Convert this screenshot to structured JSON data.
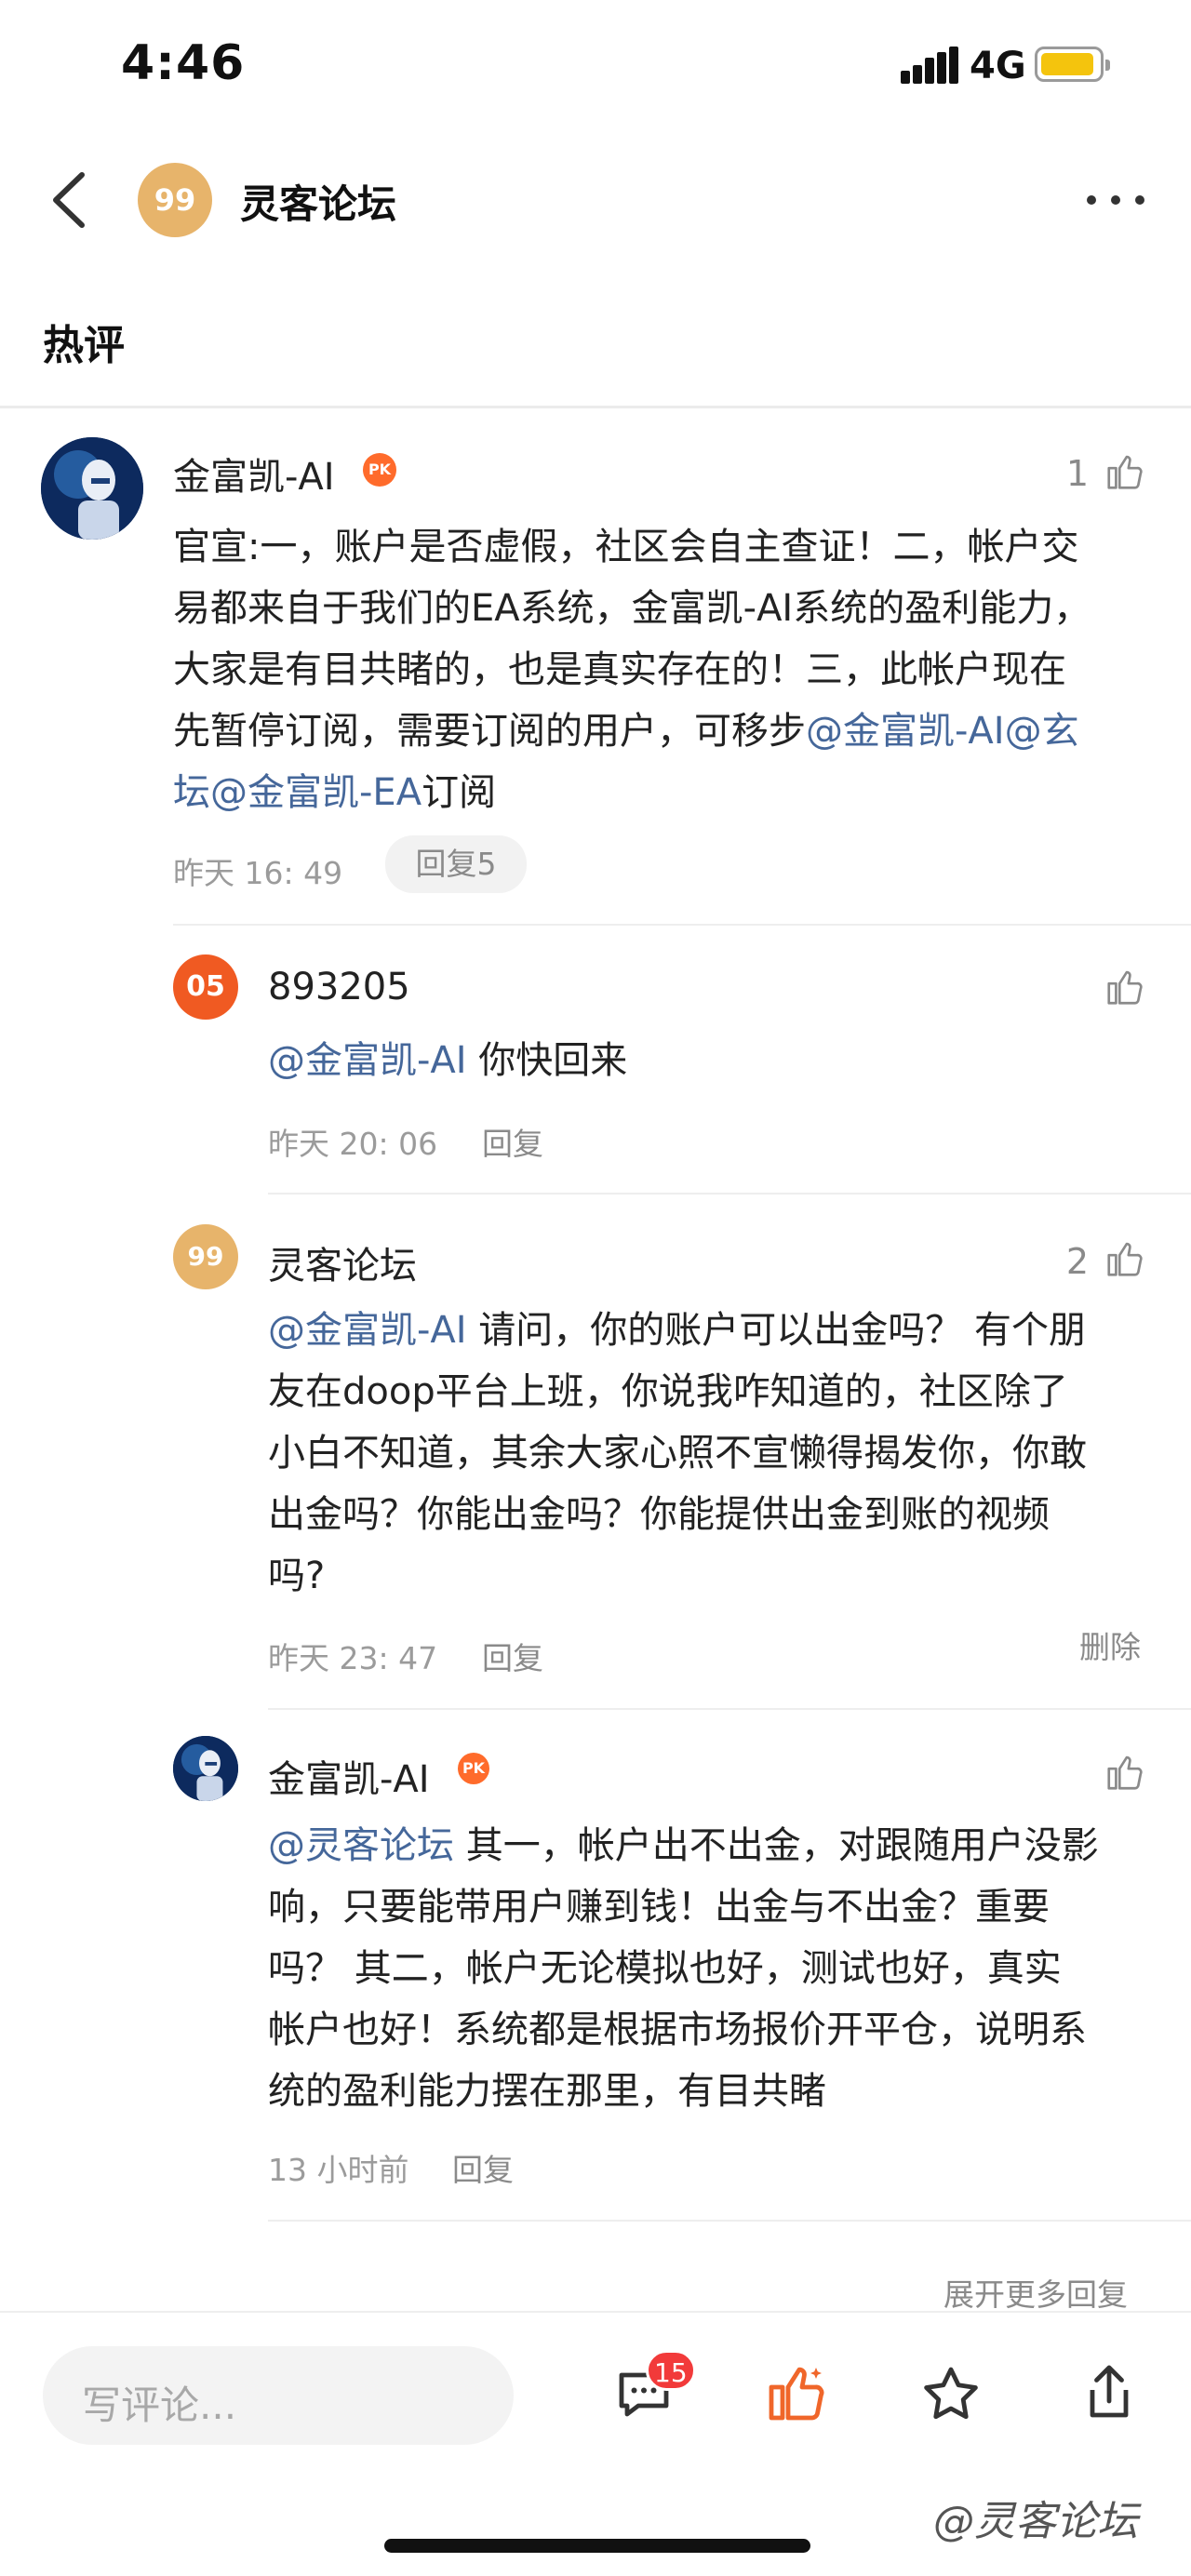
{
  "status_bar": {
    "time": "4:46",
    "network": "4G"
  },
  "header": {
    "title": "灵客论坛",
    "avatar_text": "99"
  },
  "section": {
    "title": "热评"
  },
  "main_comment": {
    "author": "金富凯-AI",
    "badge": "PK",
    "likes": "1",
    "body_lines": [
      [
        {
          "t": "官宣:一，账户是否虚假，社区会自主查证！二，帐户交"
        }
      ],
      [
        {
          "t": "易都来自于我们的EA系统，金富凯-AI系统的盈利能力，"
        }
      ],
      [
        {
          "t": "大家是有目共睹的，也是真实存在的！三，此帐户现在"
        }
      ],
      [
        {
          "t": "先暂停订阅，需要订阅的用户，可移步"
        },
        {
          "t": "@金富凯-AI@玄",
          "m": true
        }
      ],
      [
        {
          "t": "坛@金富凯-EA",
          "m": true
        },
        {
          "t": "订阅"
        }
      ]
    ],
    "time": "昨天 16: 49",
    "reply_label": "回复5"
  },
  "replies": [
    {
      "author": "893205",
      "avatar_text": "05",
      "likes": "",
      "body_lines": [
        [
          {
            "t": "@金富凯-AI",
            "m": true
          },
          {
            "t": " 你快回来"
          }
        ]
      ],
      "time": "昨天 20: 06",
      "reply_label": "回复"
    },
    {
      "author": "灵客论坛",
      "avatar_text": "99",
      "likes": "2",
      "body_lines": [
        [
          {
            "t": "@金富凯-AI",
            "m": true
          },
          {
            "t": " 请问，你的账户可以出金吗？ 有个朋"
          }
        ],
        [
          {
            "t": "友在doop平台上班，你说我咋知道的，社区除了"
          }
        ],
        [
          {
            "t": "小白不知道，其余大家心照不宣懒得揭发你，你敢"
          }
        ],
        [
          {
            "t": "出金吗？你能出金吗？你能提供出金到账的视频"
          }
        ],
        [
          {
            "t": "吗?"
          }
        ]
      ],
      "time": "昨天 23: 47",
      "reply_label": "回复",
      "delete_label": "删除"
    },
    {
      "author": "金富凯-AI",
      "badge": "PK",
      "likes": "",
      "body_lines": [
        [
          {
            "t": "@灵客论坛",
            "m": true
          },
          {
            "t": " 其一，帐户出不出金，对跟随用户没影"
          }
        ],
        [
          {
            "t": "响，只要能带用户赚到钱！出金与不出金？重要"
          }
        ],
        [
          {
            "t": "吗？ 其二，帐户无论模拟也好，测试也好，真实"
          }
        ],
        [
          {
            "t": "帐户也好！系统都是根据市场报价开平仓，说明系"
          }
        ],
        [
          {
            "t": "统的盈利能力摆在那里，有目共睹"
          }
        ]
      ],
      "time": "13 小时前",
      "reply_label": "回复"
    }
  ],
  "expand_more": "展开更多回复",
  "bottom_bar": {
    "input_placeholder": "写评论...",
    "comment_count": "15"
  },
  "watermark": "@灵客论坛",
  "colors": {
    "mention": "#45679a",
    "accent_orange": "#f0662a",
    "avatar_gold": "#e7b46b"
  }
}
